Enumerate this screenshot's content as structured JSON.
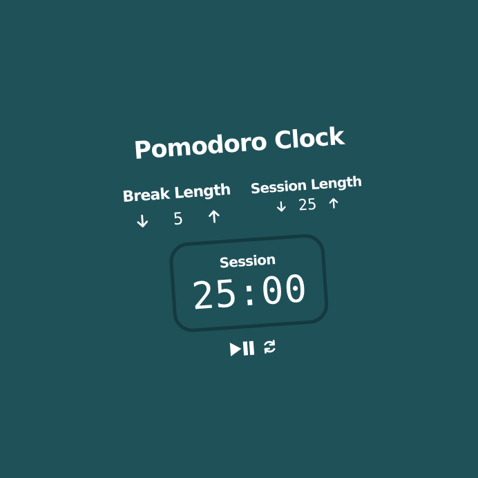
{
  "title": "Pomodoro Clock",
  "break": {
    "label": "Break Length",
    "value": "5"
  },
  "session": {
    "label": "Session Length",
    "value": "25"
  },
  "timer": {
    "label": "Session",
    "time_left": "25:00"
  },
  "icons": {
    "decrement": "arrow-down-icon",
    "increment": "arrow-up-icon",
    "start_stop": "play-pause-icon",
    "reset": "refresh-icon"
  },
  "colors": {
    "background": "#1f5159",
    "text": "#ffffff",
    "timer_border": "#143a40"
  }
}
